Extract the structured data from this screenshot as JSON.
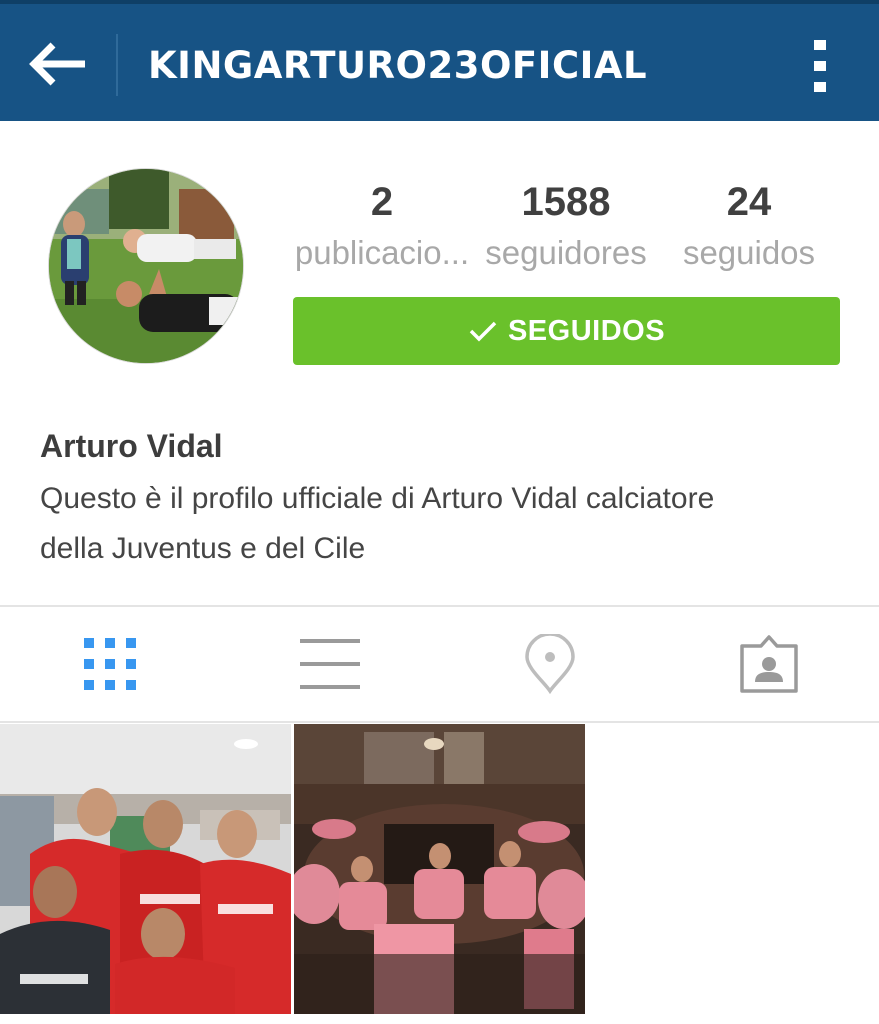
{
  "header": {
    "title": "KINGARTURO23OFICIAL",
    "back_icon": "arrow-left-icon",
    "menu_icon": "more-vertical-icon",
    "color": "#175385"
  },
  "profile": {
    "avatar_icon": "profile-photo",
    "stats": {
      "posts": {
        "value": "2",
        "label": "publicacio..."
      },
      "followers": {
        "value": "1588",
        "label": "seguidores"
      },
      "following": {
        "value": "24",
        "label": "seguidos"
      }
    },
    "follow_button": {
      "label": "SEGUIDOS",
      "icon": "check-icon",
      "color": "#6ac12b"
    },
    "name": "Arturo Vidal",
    "bio_line1": "Questo è il profilo ufficiale di Arturo Vidal calciatore",
    "bio_line2": "della Juventus e del Cile"
  },
  "tabs": [
    {
      "icon": "grid-icon",
      "active": true,
      "color": "#3897f0"
    },
    {
      "icon": "list-icon",
      "active": false
    },
    {
      "icon": "location-pin-icon",
      "active": false
    },
    {
      "icon": "tagged-person-icon",
      "active": false
    }
  ],
  "posts": [
    {
      "image": "team-photo-red-jerseys"
    },
    {
      "image": "team-dinner-photo"
    }
  ]
}
